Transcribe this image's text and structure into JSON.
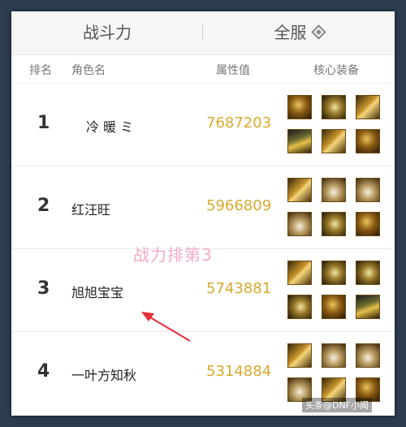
{
  "tabs": {
    "left_label": "战斗力",
    "right_label": "全服"
  },
  "columns": {
    "rank": "排名",
    "name": "角色名",
    "power": "属性值",
    "gear": "核心装备"
  },
  "rows": [
    {
      "rank": "1",
      "name": "冷 暖 ミ",
      "power": "7687203"
    },
    {
      "rank": "2",
      "name": "红汪旺",
      "power": "5966809"
    },
    {
      "rank": "3",
      "name": "旭旭宝宝",
      "power": "5743881"
    },
    {
      "rank": "4",
      "name": "一叶方知秋",
      "power": "5314884"
    }
  ],
  "annotation": "战力排第3",
  "footer": "头条@DNF小闻",
  "colors": {
    "power_text": "#d9a92c",
    "annotation_text": "#f4a6c6",
    "arrow": "#e0303a"
  }
}
